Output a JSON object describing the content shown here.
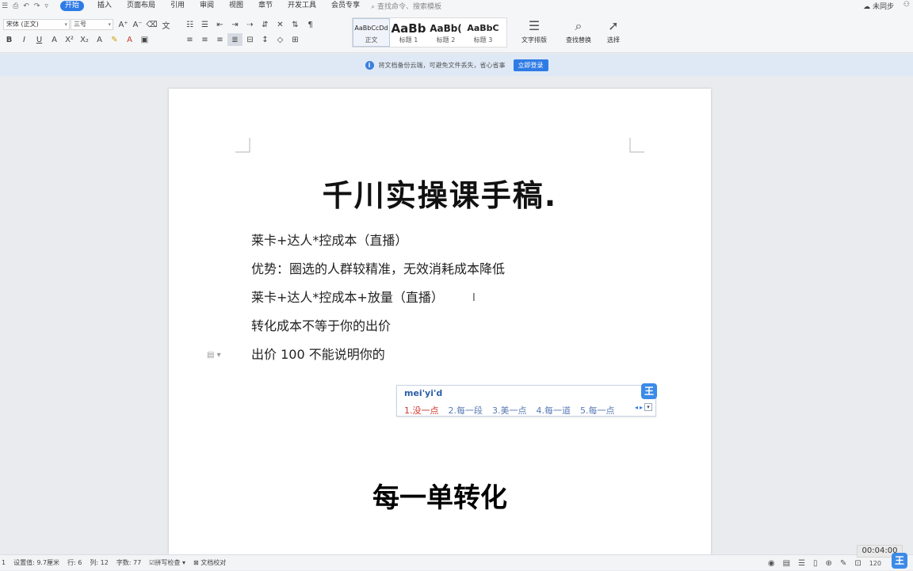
{
  "menubar": {
    "items": [
      "开始",
      "插入",
      "页面布局",
      "引用",
      "审阅",
      "视图",
      "章节",
      "开发工具",
      "会员专享"
    ],
    "active": "开始",
    "search_placeholder": "查找命令、搜索模板",
    "sync_label": "未同步"
  },
  "ribbon": {
    "font_name": "宋体 (正文)",
    "font_size": "三号",
    "styles": [
      {
        "preview": "AaBbCcDd",
        "label": "正文"
      },
      {
        "preview": "AaBb",
        "label": "标题 1"
      },
      {
        "preview": "AaBb(",
        "label": "标题 2"
      },
      {
        "preview": "AaBbC",
        "label": "标题 3"
      }
    ],
    "text_layout_label": "文字排版",
    "find_replace_label": "查找替换",
    "select_label": "选择"
  },
  "notice": {
    "text": "将文档备份云端，可避免文件丢失，省心省事",
    "button": "立即登录"
  },
  "document": {
    "title": "千川实操课手稿.",
    "paragraphs": [
      "莱卡+达人*控成本（直播）",
      "优势：圈选的人群较精准，无效消耗成本降低",
      "莱卡+达人*控成本+放量（直播）",
      "转化成本不等于你的出价",
      "出价 100 不能说明你的"
    ],
    "subtitle": "每一单转化"
  },
  "ime": {
    "composition": "mei'yi'd",
    "candidates": [
      "1.没一点",
      "2.每一段",
      "3.美一点",
      "4.每一道",
      "5.每一点"
    ],
    "logo": "王"
  },
  "status": {
    "page": "1",
    "setting": "设置值: 9.7厘米",
    "row": "行: 6",
    "col": "列: 12",
    "word_count": "字数: 77",
    "spell_check": "拼写检查",
    "doc_check": "文档校对",
    "zoom": "120",
    "timer": "00:04:00"
  }
}
